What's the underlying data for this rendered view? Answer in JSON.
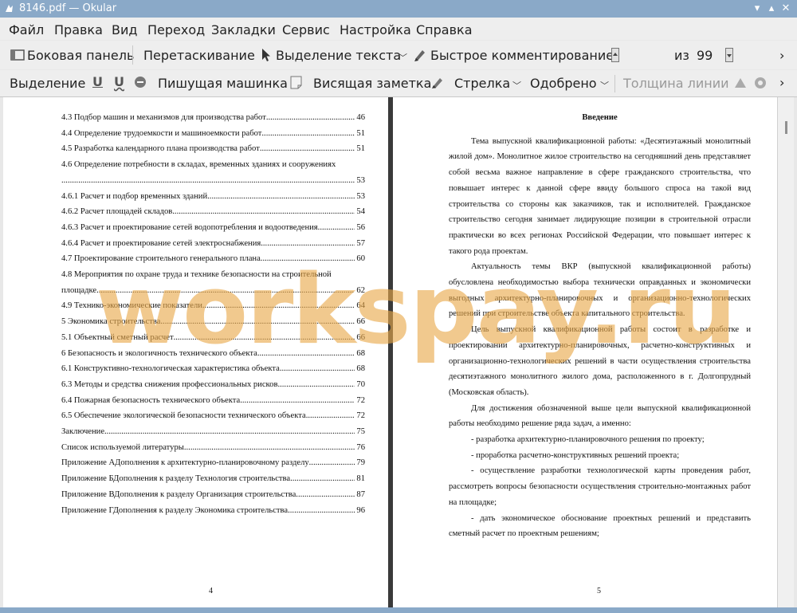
{
  "window": {
    "title": "8146.pdf — Okular"
  },
  "menu": [
    "Файл",
    "Правка",
    "Вид",
    "Переход",
    "Закладки",
    "Сервис",
    "Настройка",
    "Справка"
  ],
  "toolbar1": {
    "sidebar": "Боковая панель",
    "browse": "Перетаскивание",
    "text_select": "Выделение текста",
    "quick_annot": "Быстрое комментирование",
    "page_value": "4",
    "of_label": "из",
    "page_total": "99"
  },
  "toolbar2": {
    "highlight": "Выделение",
    "typewriter": "Пишущая машинка",
    "note": "Висящая заметка",
    "arrow": "Стрелка",
    "stamp": "Одобрено",
    "line_width": "Толщина линии"
  },
  "left_page": {
    "toc": [
      {
        "t": "4.3 Подбор машин и механизмов для производства работ",
        "p": "46"
      },
      {
        "t": "4.4 Определение трудоемкости и машиноемкости работ",
        "p": "51"
      },
      {
        "t": "4.5 Разработка календарного плана производства работ",
        "p": "51"
      },
      {
        "t": "4.6 Определение потребности в складах, временных зданиях и сооружениях",
        "p": "53",
        "wrap": true
      },
      {
        "t": "4.6.1 Расчет и подбор временных зданий",
        "p": "53"
      },
      {
        "t": "4.6.2 Расчет площадей складов",
        "p": "54"
      },
      {
        "t": "4.6.3 Расчет и проектирование сетей водопотребления и водоотведения",
        "p": "56"
      },
      {
        "t": "4.6.4 Расчет и проектирование сетей электроснабжения",
        "p": "57"
      },
      {
        "t": "4.7 Проектирование строительного генерального плана",
        "p": "60"
      },
      {
        "t": "4.8 Мероприятия по охране труда и технике безопасности на строительной площадке",
        "p": "62",
        "wrap2": true
      },
      {
        "t": "4.9 Технико-экономические показатели",
        "p": "64"
      },
      {
        "t": "5 Экономика строительства",
        "p": "66"
      },
      {
        "t": "5.1 Объектный сметный расчет",
        "p": "66"
      },
      {
        "t": "6 Безопасность и экологичность технического объекта",
        "p": "68"
      },
      {
        "t": "6.1 Конструктивно-технологическая характеристика объекта",
        "p": "68"
      },
      {
        "t": "6.3 Методы и средства снижения профессиональных рисков",
        "p": "70"
      },
      {
        "t": "6.4 Пожарная безопасность технического объекта",
        "p": "72"
      },
      {
        "t": "6.5 Обеспечение экологической безопасности технического объекта",
        "p": "72"
      },
      {
        "t": "Заключение",
        "p": "75"
      },
      {
        "t": "Список используемой литературы",
        "p": "76"
      },
      {
        "t": "Приложение АДополнения к архитектурно-планировочному разделу",
        "p": "79"
      },
      {
        "t": "Приложение БДополнения к разделу Технология строительства",
        "p": "81"
      },
      {
        "t": "Приложение ВДополнения к разделу Организация строительства",
        "p": "87"
      },
      {
        "t": "Приложение ГДополнения к разделу Экономика строительства",
        "p": "96"
      }
    ],
    "page_number": "4"
  },
  "right_page": {
    "heading": "Введение",
    "paragraphs": [
      "Тема выпускной квалификационной работы: «Десятиэтажный монолитный жилой дом». Монолитное жилое строительство на сегодняшний день представляет собой весьма важное направление в сфере гражданского строительства, что повышает интерес к данной сфере ввиду большого спроса на такой вид строительства со стороны как заказчиков, так и исполнителей. Гражданское строительство сегодня занимает лидирующие позиции в строительной отрасли практически во всех регионах Российской Федерации, что повышает интерес к такого рода проектам.",
      "Актуальность темы ВКР (выпускной квалификационной работы) обусловлена необходимостью выбора технически оправданных и экономически выгодных архитектурно-планировочных и организационно-технологических решений при строительстве объекта капитального строительства.",
      "Цель выпускной квалификационной работы состоит в разработке и проектировании архитектурно-планировочных, расчетно-конструктивных и организационно-технологических решений в части осуществления строительства десятиэтажного монолитного жилого дома, расположенного в г. Долгопрудный (Московская область).",
      "Для достижения обозначенной выше цели выпускной квалификационной работы необходимо решение ряда задач, а именно:",
      "- разработка архитектурно-планировочного решения по проекту;",
      "- проработка расчетно-конструктивных решений проекта;",
      "- осуществление разработки технологической карты проведения работ, рассмотреть вопросы безопасности осуществления строительно-монтажных работ на площадке;",
      "- дать экономическое обоснование проектных решений и представить сметный расчет по проектным решениям;"
    ],
    "page_number": "5"
  },
  "watermark": "workspay.ru"
}
